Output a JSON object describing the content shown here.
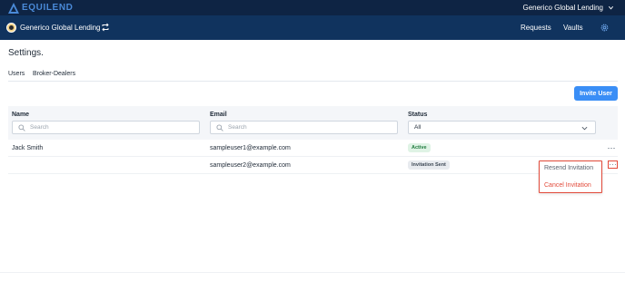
{
  "brand": {
    "name": "EQUILEND",
    "accent_color": "#4a8ad8",
    "logo_icon": "equilend-logo-icon"
  },
  "topbar": {
    "org_switch_label": "Generico Global Lending",
    "org_switch_icon": "chevron-down-icon"
  },
  "navbar": {
    "org_name": "Generico Global Lending",
    "swap_icon": "swap-icon",
    "links": {
      "requests": "Requests",
      "vaults": "Vaults"
    },
    "settings_icon": "gear-icon"
  },
  "page": {
    "title": "Settings."
  },
  "tabs": {
    "users": "Users",
    "broker_dealers": "Broker-Dealers",
    "active_tab": "Users"
  },
  "actions": {
    "invite_user": "Invite User"
  },
  "table": {
    "columns": {
      "name": {
        "label": "Name",
        "placeholder": "Search"
      },
      "email": {
        "label": "Email",
        "placeholder": "Search"
      },
      "status": {
        "label": "Status",
        "selected": "All"
      }
    },
    "rows": [
      {
        "name": "Jack Smith",
        "email": "sampleuser1@example.com",
        "status": "Active"
      },
      {
        "name": "",
        "email": "sampleuser2@example.com",
        "status": "Invitation Sent"
      }
    ]
  },
  "row_menu": {
    "items": {
      "resend": "Resend Invitation",
      "cancel": "Cancel Invitation"
    },
    "highlight_color": "#e24a3a"
  },
  "colors": {
    "topbar": "#0e2444",
    "navbar": "#10335e",
    "primary_button": "#3a8ef6",
    "active_tab_underline": "#e0572c"
  }
}
